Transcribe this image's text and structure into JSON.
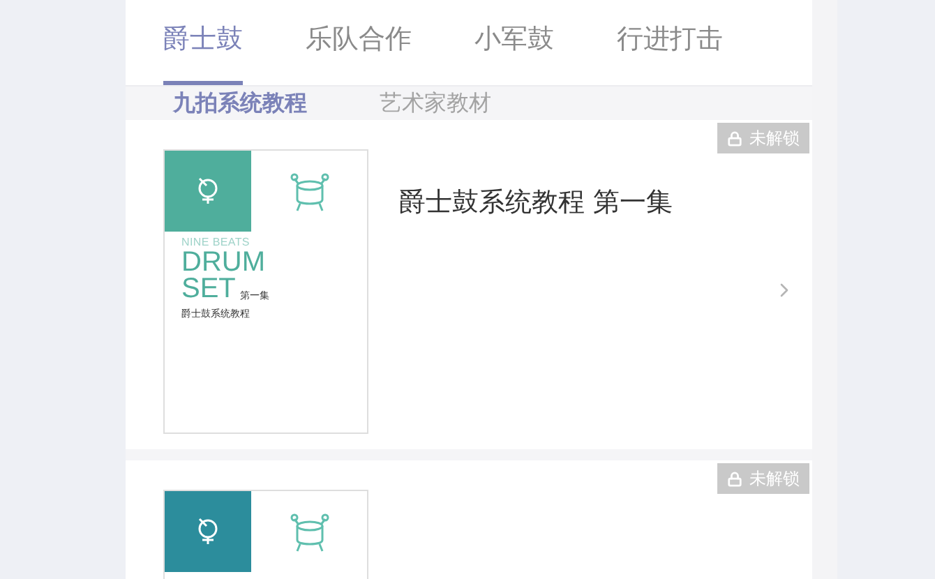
{
  "tabs": [
    {
      "label": "爵士鼓",
      "selected": true
    },
    {
      "label": "乐队合作",
      "selected": false
    },
    {
      "label": "小军鼓",
      "selected": false
    },
    {
      "label": "行进打击",
      "selected": false
    }
  ],
  "subtabs": [
    {
      "label": "九拍系统教程",
      "selected": true
    },
    {
      "label": "艺术家教材",
      "selected": false
    }
  ],
  "courses": [
    {
      "title": "爵士鼓系统教程 第一集",
      "badge": "未解锁",
      "locked": true,
      "cover": {
        "series": "NINE BEATS",
        "word_1": "DRUM",
        "word_2": "SET",
        "volume": "第一集",
        "subtitle": "爵士鼓系统教程"
      }
    },
    {
      "badge": "未解锁",
      "locked": true
    }
  ]
}
